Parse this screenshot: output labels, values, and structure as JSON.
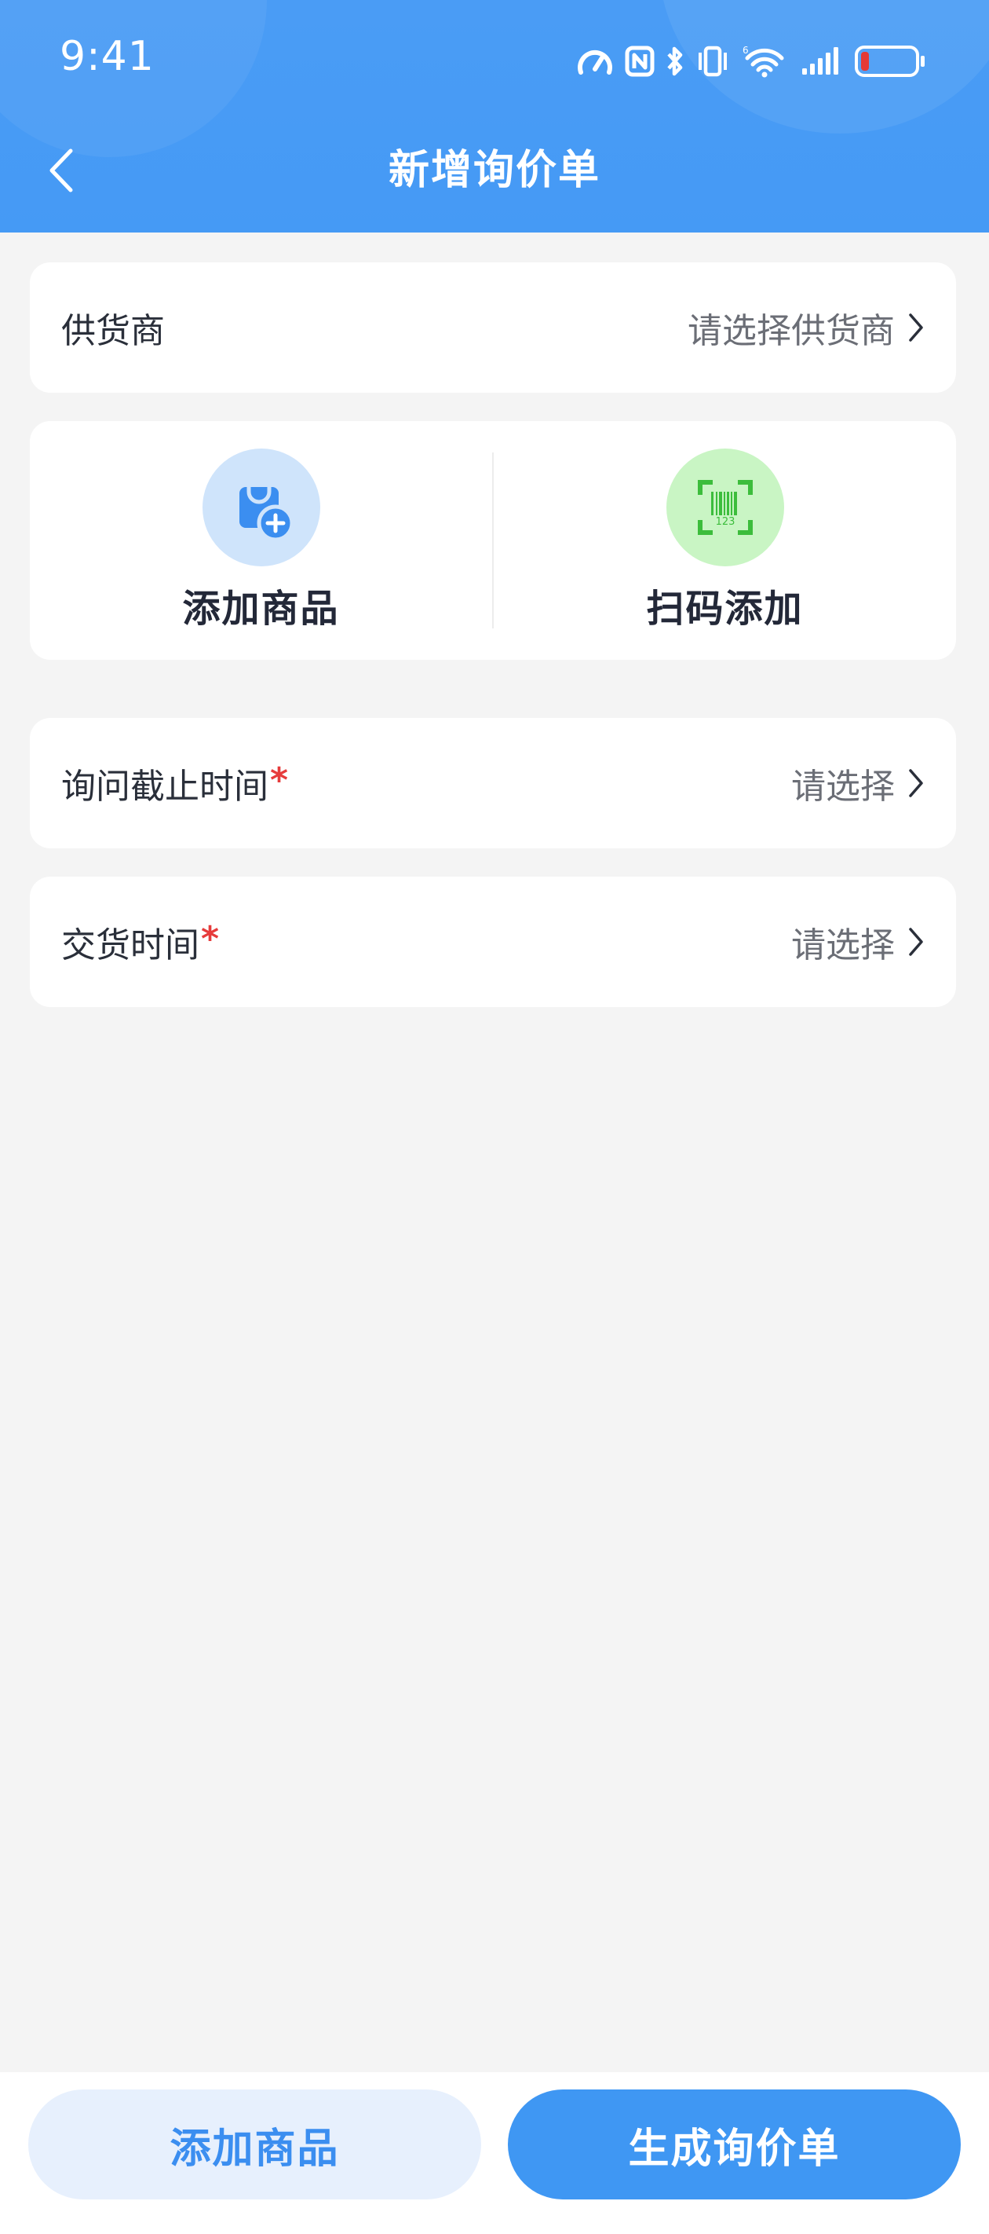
{
  "status_bar": {
    "time": "9:41"
  },
  "header": {
    "title": "新增询价单"
  },
  "supplier": {
    "label": "供货商",
    "value": "请选择供货商"
  },
  "actions": {
    "add_product": "添加商品",
    "scan_add": "扫码添加",
    "barcode_digits": "123"
  },
  "deadline": {
    "label": "询问截止时间",
    "required_mark": "*",
    "value": "请选择"
  },
  "delivery": {
    "label": "交货时间",
    "required_mark": "*",
    "value": "请选择"
  },
  "footer": {
    "add_product_button": "添加商品",
    "generate_button": "生成询价单"
  },
  "colors": {
    "header_blue": "#4a9cf5",
    "primary_button": "#3f97f3",
    "secondary_button_bg": "#e7f0fd",
    "required_red": "#e63b3b",
    "scan_green": "#4cc94c"
  },
  "icons": [
    "back-arrow-icon",
    "chevron-right-icon",
    "shopping-bag-add-icon",
    "barcode-scan-icon",
    "wifi-icon",
    "signal-icon",
    "battery-icon",
    "bluetooth-icon",
    "nfc-icon",
    "vibrate-icon",
    "speedometer-icon"
  ]
}
